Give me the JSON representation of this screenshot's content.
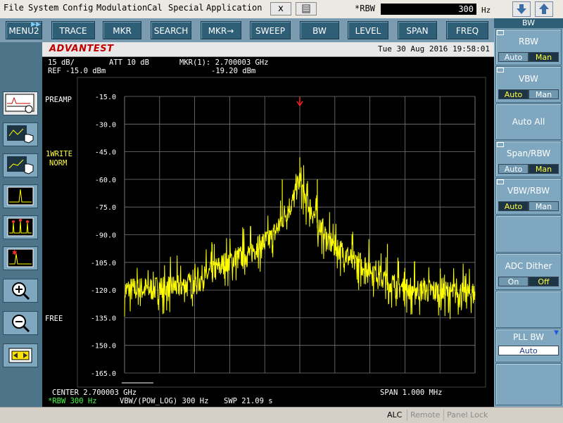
{
  "menubar": {
    "items": [
      "File",
      "System",
      "Config",
      "Modulation",
      "Cal",
      "Special",
      "Application"
    ],
    "close_label": "x",
    "rbw_label": "*RBW",
    "rbw_value": "300",
    "rbw_unit": "Hz"
  },
  "softkeys": [
    "MENU2",
    "TRACE",
    "MKR",
    "SEARCH",
    "MKR→",
    "SWEEP",
    "BW",
    "LEVEL",
    "SPAN",
    "FREQ"
  ],
  "left_tools": [
    "trace-select-icon",
    "cursor-move-icon",
    "cursor-drag-icon",
    "single-peak-icon",
    "multi-peak-icon",
    "marker-peak-icon",
    "zoom-in-icon",
    "zoom-out-icon",
    "span-expand-icon"
  ],
  "screen": {
    "logo": "ADVANTEST",
    "datetime": "Tue 30 Aug 2016 19:58:01",
    "scale": "15 dB/",
    "att": "ATT 10 dB",
    "mkr_label": "MKR(1): 2.700003 GHz",
    "mkr_level": "-19.20 dBm",
    "ref": "REF -15.0 dBm",
    "preamp": "PREAMP",
    "trace_mode1": "1WRITE",
    "trace_mode2": "NORM",
    "free": "FREE",
    "y_ticks": [
      "-15.0",
      "-30.0",
      "-45.0",
      "-60.0",
      "-75.0",
      "-90.0",
      "-105.0",
      "-120.0",
      "-135.0",
      "-150.0",
      "-165.0"
    ],
    "center": "CENTER 2.700003 GHz",
    "span": "SPAN 1.000 MHz",
    "rbw": "*RBW 300 Hz",
    "vbw": "VBW/(POW_LOG) 300 Hz",
    "swp": "SWP 21.09 s"
  },
  "right_panel": {
    "title": "BW",
    "rbw": {
      "label": "RBW",
      "opt1": "Auto",
      "opt2": "Man",
      "selected": "Man"
    },
    "vbw": {
      "label": "VBW",
      "opt1": "Auto",
      "opt2": "Man",
      "selected": "Auto"
    },
    "auto_all": "Auto All",
    "span_rbw": {
      "label": "Span/RBW",
      "opt1": "Auto",
      "opt2": "Man",
      "selected": "Man"
    },
    "vbw_rbw": {
      "label": "VBW/RBW",
      "opt1": "Auto",
      "opt2": "Man",
      "selected": "Auto"
    },
    "adc_dither": {
      "label": "ADC Dither",
      "opt1": "On",
      "opt2": "Off",
      "selected": "Off"
    },
    "pll_bw": {
      "label": "PLL BW",
      "value": "Auto"
    }
  },
  "status": {
    "alc": "ALC",
    "remote": "Remote",
    "panel_lock": "Panel Lock"
  },
  "colors": {
    "trace": "#ffff00",
    "marker": "#ff2020",
    "softkey": "#2f5f77",
    "panel": "#7fa8c0"
  },
  "chart_data": {
    "type": "line",
    "xlabel": "",
    "ylabel": "",
    "x_center_ghz": 2.700003,
    "x_span_mhz": 1.0,
    "ylim": [
      -165,
      -15
    ],
    "x_offsets_khz": [
      -500,
      -400,
      -300,
      -250,
      -200,
      -150,
      -120,
      -100,
      -80,
      -60,
      -40,
      -20,
      -10,
      0,
      10,
      20,
      40,
      60,
      80,
      100,
      120,
      150,
      200,
      250,
      300,
      400,
      500
    ],
    "levels_dbm": [
      -120,
      -119,
      -117,
      -110,
      -104,
      -101,
      -96,
      -94,
      -92,
      -85,
      -78,
      -72,
      -66,
      -60,
      -67,
      -72,
      -79,
      -86,
      -93,
      -96,
      -99,
      -104,
      -108,
      -116,
      -119,
      -121,
      -122
    ],
    "spurs_khz": [
      -300,
      -250,
      -150,
      -100,
      -50,
      0,
      50,
      100,
      150,
      250,
      300
    ],
    "spur_levels_dbm": [
      -108,
      -95,
      -101,
      -90,
      -60,
      -48,
      -60,
      -90,
      -101,
      -95,
      -108
    ],
    "marker_khz": 0,
    "marker_dbm": -19.2
  }
}
